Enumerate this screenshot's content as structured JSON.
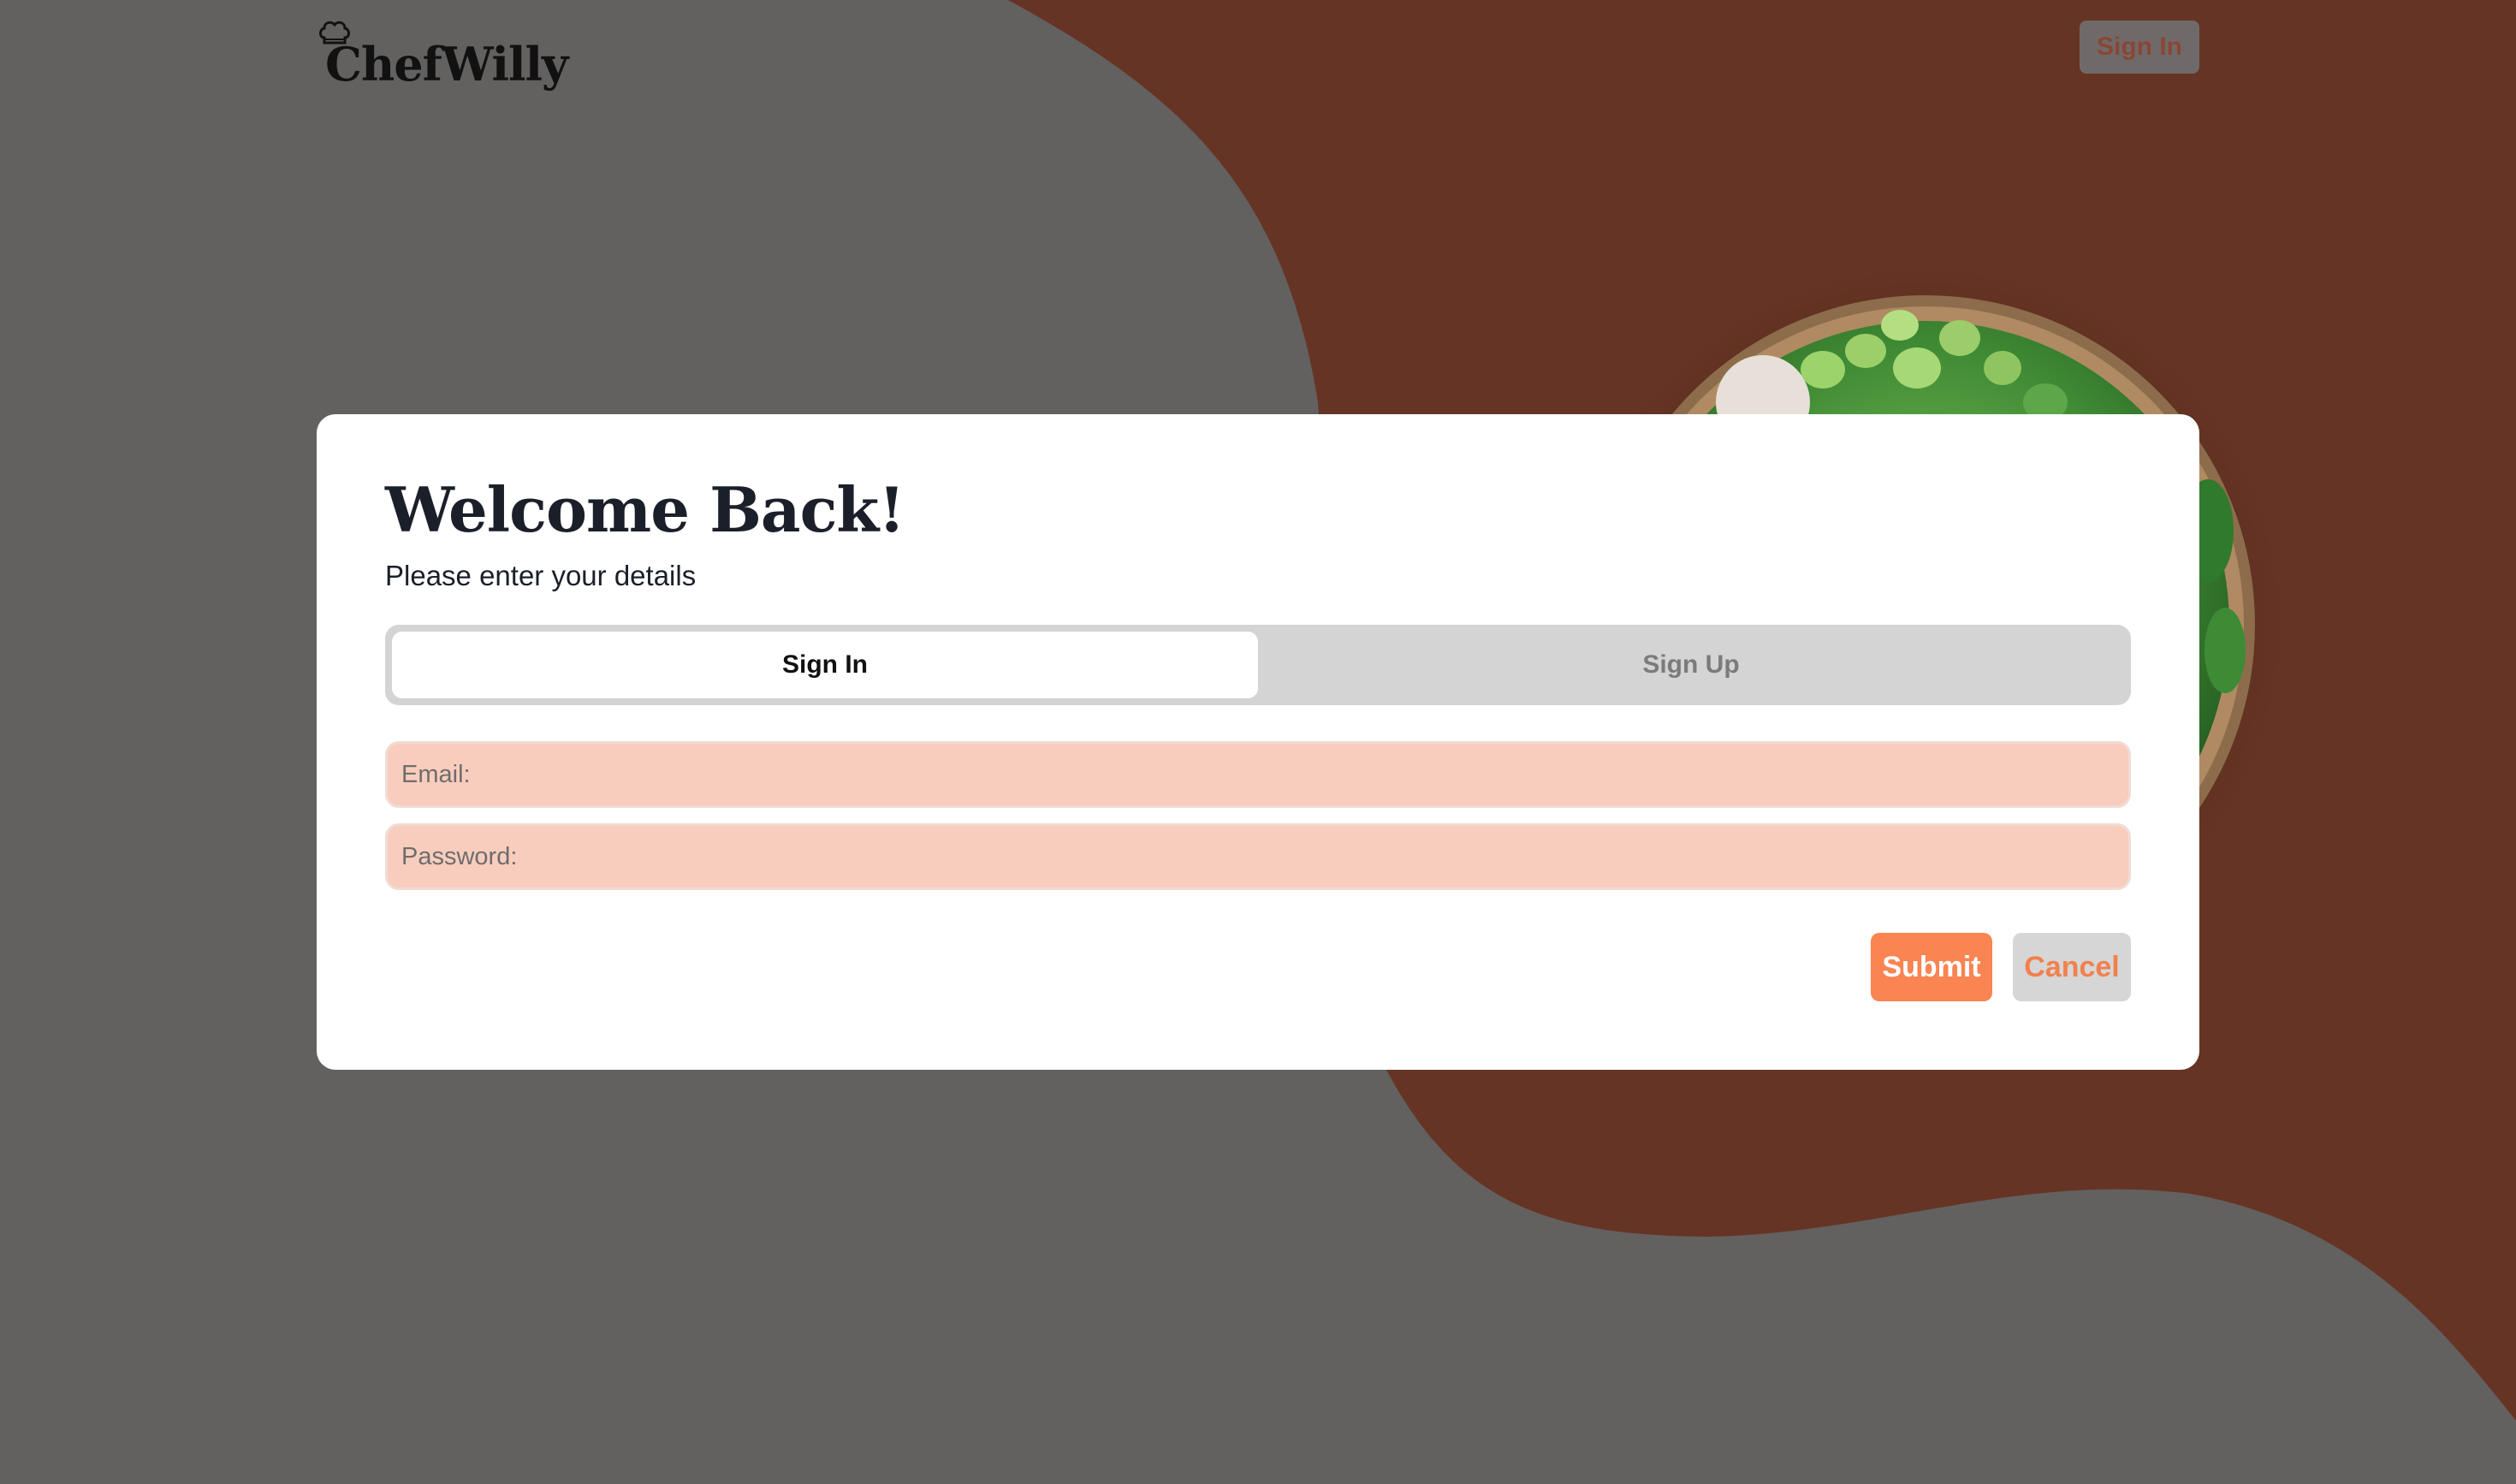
{
  "app": {
    "logo_text": "ChefWilly"
  },
  "header": {
    "signin_label": "Sign In"
  },
  "card": {
    "title": "Welcome Back!",
    "subtitle": "Please enter your details",
    "tabs": [
      {
        "label": "Sign In",
        "active": true
      },
      {
        "label": "Sign Up",
        "active": false
      }
    ],
    "email": {
      "placeholder": "Email:",
      "value": ""
    },
    "password": {
      "placeholder": "Password:",
      "value": ""
    },
    "submit_label": "Submit",
    "cancel_label": "Cancel"
  },
  "colors": {
    "page_background": "#636060",
    "accent_brown": "#663424",
    "field_background": "#f8cdbd",
    "submit_background": "#fa8452",
    "cancel_text": "#f2804e"
  },
  "icons": {
    "logo_hat": "chef-hat-icon",
    "hero_image": "salad-bowl-image"
  }
}
